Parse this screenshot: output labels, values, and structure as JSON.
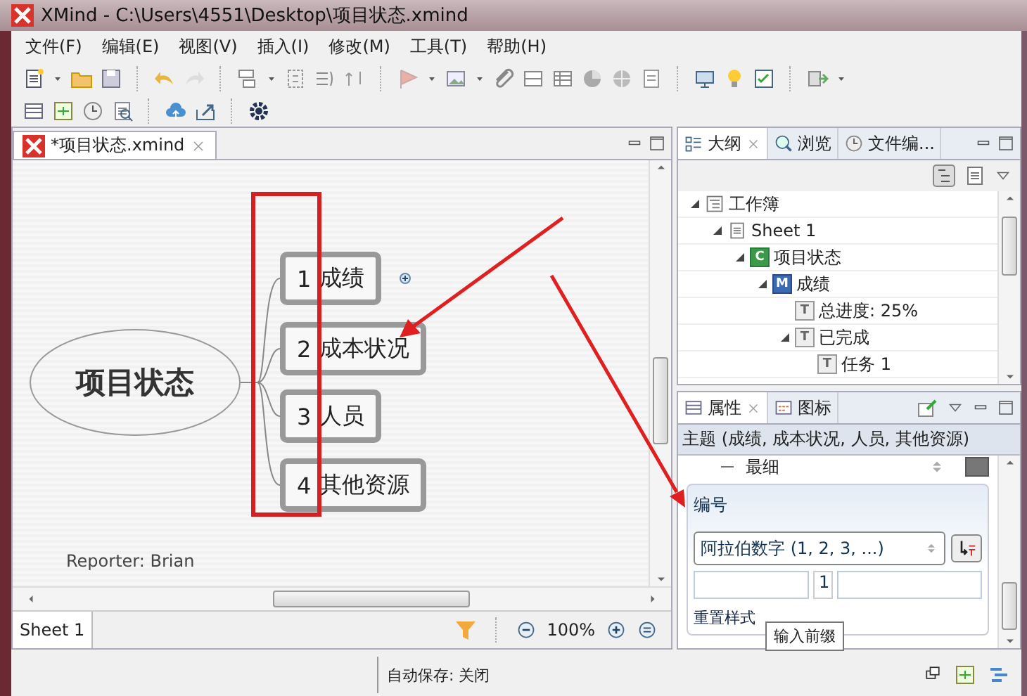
{
  "window": {
    "title": "XMind - C:\\Users\\4551\\Desktop\\项目状态.xmind"
  },
  "menu": [
    "文件(F)",
    "编辑(E)",
    "视图(V)",
    "插入(I)",
    "修改(M)",
    "工具(T)",
    "帮助(H)"
  ],
  "editor": {
    "tab": {
      "label": "*项目状态.xmind",
      "selected": true
    },
    "map": {
      "central": "项目状态",
      "note": "Reporter: Brian",
      "topics": [
        {
          "number": "1",
          "label": "成绩",
          "collapsed": true
        },
        {
          "number": "2",
          "label": "成本状况",
          "collapsed": false
        },
        {
          "number": "3",
          "label": "人员",
          "collapsed": false
        },
        {
          "number": "4",
          "label": "其他资源",
          "collapsed": false
        }
      ]
    },
    "sheet_tabs": [
      {
        "label": "Sheet 1",
        "selected": true
      }
    ],
    "zoom": "100%"
  },
  "outline_panel": {
    "tabs": [
      {
        "label": "大纲",
        "selected": true
      },
      {
        "label": "浏览",
        "selected": false
      },
      {
        "label": "文件编...",
        "selected": false
      }
    ],
    "tree": [
      {
        "label": "工作簿",
        "kind": "workbook",
        "expanded": true,
        "children": [
          {
            "label": "Sheet 1",
            "kind": "sheet",
            "expanded": true,
            "children": [
              {
                "label": "项目状态",
                "kind": "central",
                "icon_letter": "C",
                "expanded": true,
                "children": [
                  {
                    "label": "成绩",
                    "kind": "main",
                    "icon_letter": "M",
                    "expanded": true,
                    "children": [
                      {
                        "label": "总进度: 25%",
                        "kind": "sub",
                        "icon_letter": "T",
                        "expanded": false
                      },
                      {
                        "label": "已完成",
                        "kind": "sub",
                        "icon_letter": "T",
                        "expanded": true,
                        "children": [
                          {
                            "label": "任务 1",
                            "kind": "sub",
                            "icon_letter": "T",
                            "expanded": false
                          }
                        ]
                      }
                    ]
                  }
                ]
              }
            ]
          }
        ]
      }
    ]
  },
  "properties_panel": {
    "tabs": [
      {
        "label": "属性",
        "selected": true
      },
      {
        "label": "图标",
        "selected": false
      }
    ],
    "subject": "主题 (成绩, 成本状况, 人员, 其他资源)",
    "line_width": "最细",
    "section": "编号",
    "numbering": "阿拉伯数字 (1, 2, 3, ...)",
    "start": "1",
    "tooltip": "输入前缀",
    "reset": "重置样式"
  },
  "status_bar": {
    "autosave": "自动保存: 关闭"
  }
}
